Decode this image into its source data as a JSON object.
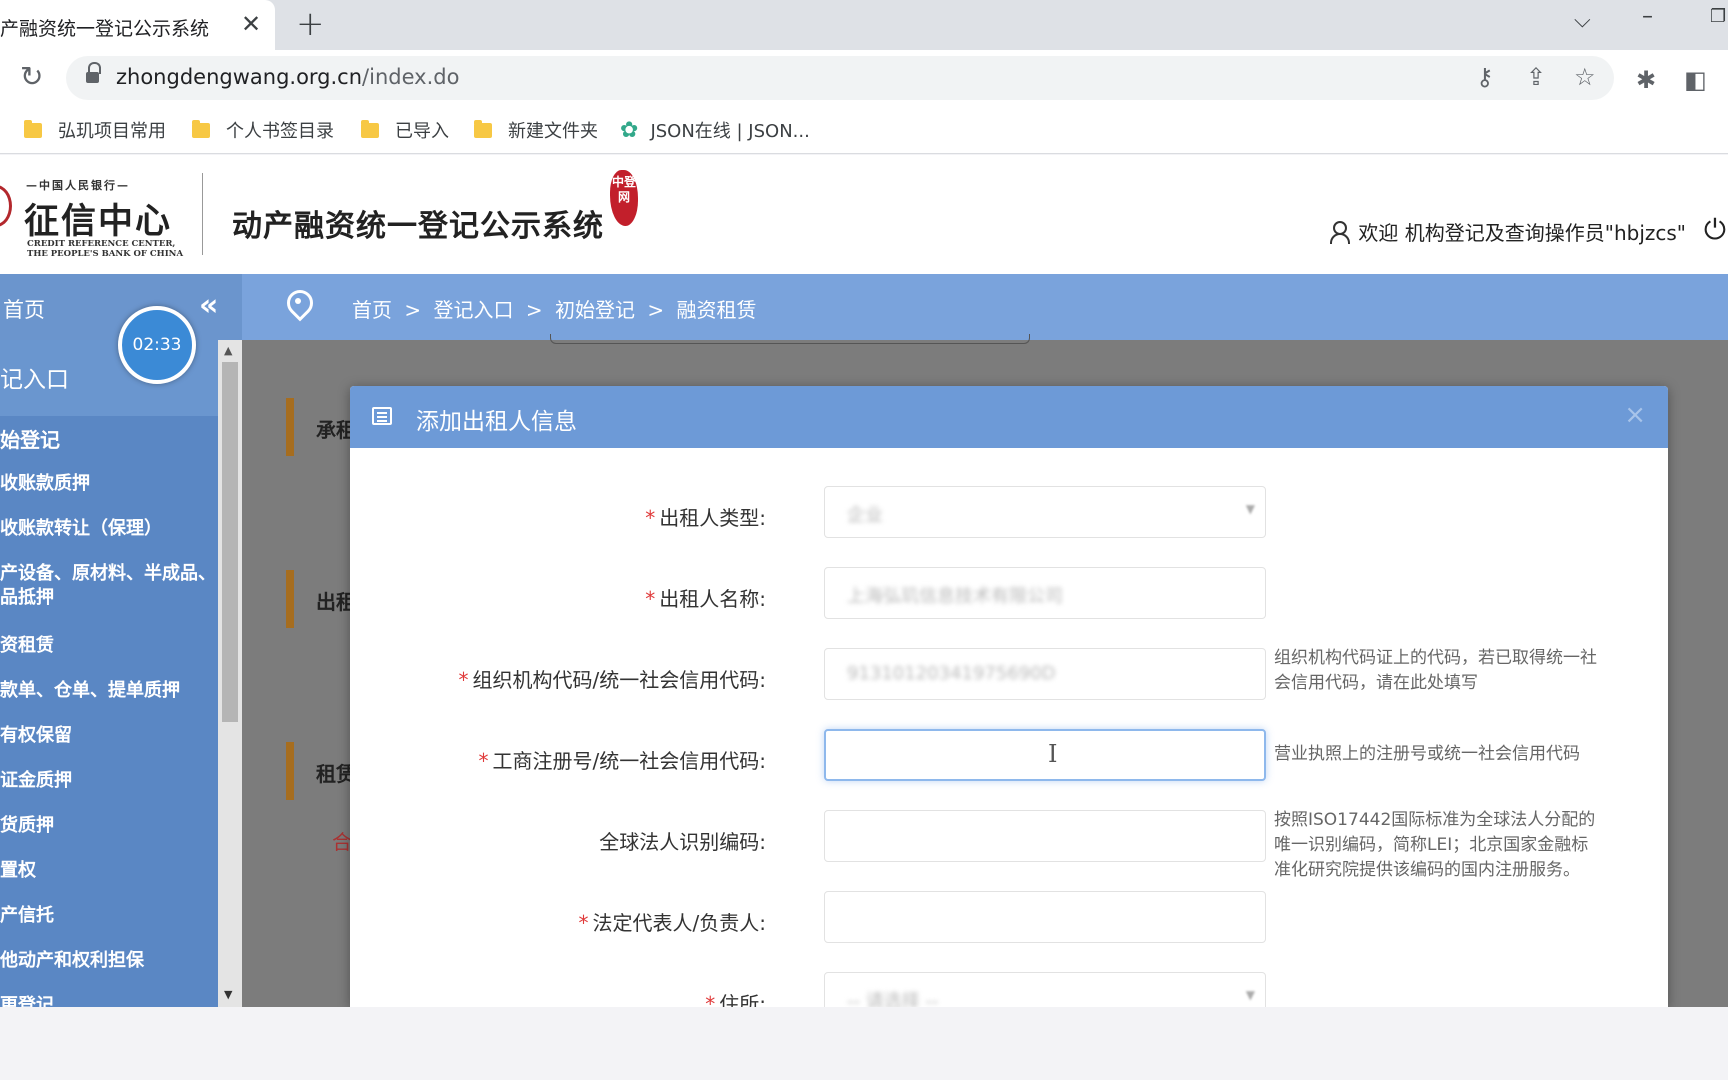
{
  "browser": {
    "tab_title": "产融资统一登记公示系统",
    "tab_close": "✕",
    "new_tab": "+",
    "url_host": "zhongdengwang.org.cn",
    "url_path": "/index.do",
    "bookmarks": [
      "弘玑项目常用",
      "个人书签目录",
      "已导入",
      "新建文件夹",
      "JSON在线 | JSON..."
    ]
  },
  "header": {
    "logo_top": "—中国人民银行—",
    "logo_main": "征信中心",
    "logo_en_1": "CREDIT REFERENCE CENTER,",
    "logo_en_2": "THE PEOPLE'S BANK OF CHINA",
    "system_title": "动产融资统一登记公示系统",
    "stamp": "中登网",
    "welcome": "欢迎 机构登记及查询操作员\"hbjzcs\""
  },
  "sidebar": {
    "home": "首页",
    "timer": "02:33",
    "section": "记入口",
    "items": [
      "始登记",
      "收账款质押",
      "收账款转让（保理）",
      "产设备、原材料、半成品、品抵押",
      "资租赁",
      "款单、仓单、提单质押",
      "有权保留",
      "证金质押",
      "货质押",
      "置权",
      "产信托",
      "他动产和权利担保",
      "更登记"
    ]
  },
  "breadcrumb": [
    "首页",
    ">",
    "登记入口",
    ">",
    "初始登记",
    ">",
    "融资租赁"
  ],
  "background_sections": [
    "承租",
    "出租",
    "租赁",
    "合"
  ],
  "modal": {
    "title": "添加出租人信息",
    "close": "×",
    "fields": [
      {
        "label": "出租人类型:",
        "required": true,
        "value": "企业",
        "type": "select",
        "hint": ""
      },
      {
        "label": "出租人名称:",
        "required": true,
        "value": "上海弘玑信息技术有限公司",
        "type": "text",
        "hint": ""
      },
      {
        "label": "组织机构代码/统一社会信用代码:",
        "required": true,
        "value": "91310120341975690D",
        "type": "text",
        "hint": "组织机构代码证上的代码，若已取得统一社会信用代码，请在此处填写"
      },
      {
        "label": "工商注册号/统一社会信用代码:",
        "required": true,
        "value": "",
        "type": "text",
        "hint": "营业执照上的注册号或统一社会信用代码"
      },
      {
        "label": "全球法人识别编码:",
        "required": false,
        "value": "",
        "type": "text",
        "hint": "按照ISO17442国际标准为全球法人分配的唯一识别编码，简称LEI；北京国家金融标准化研究院提供该编码的国内注册服务。"
      },
      {
        "label": "法定代表人/负责人:",
        "required": true,
        "value": "",
        "type": "text",
        "hint": ""
      },
      {
        "label": "住所:",
        "required": true,
        "value": "-- 请选择 --",
        "type": "select",
        "hint": ""
      }
    ]
  }
}
